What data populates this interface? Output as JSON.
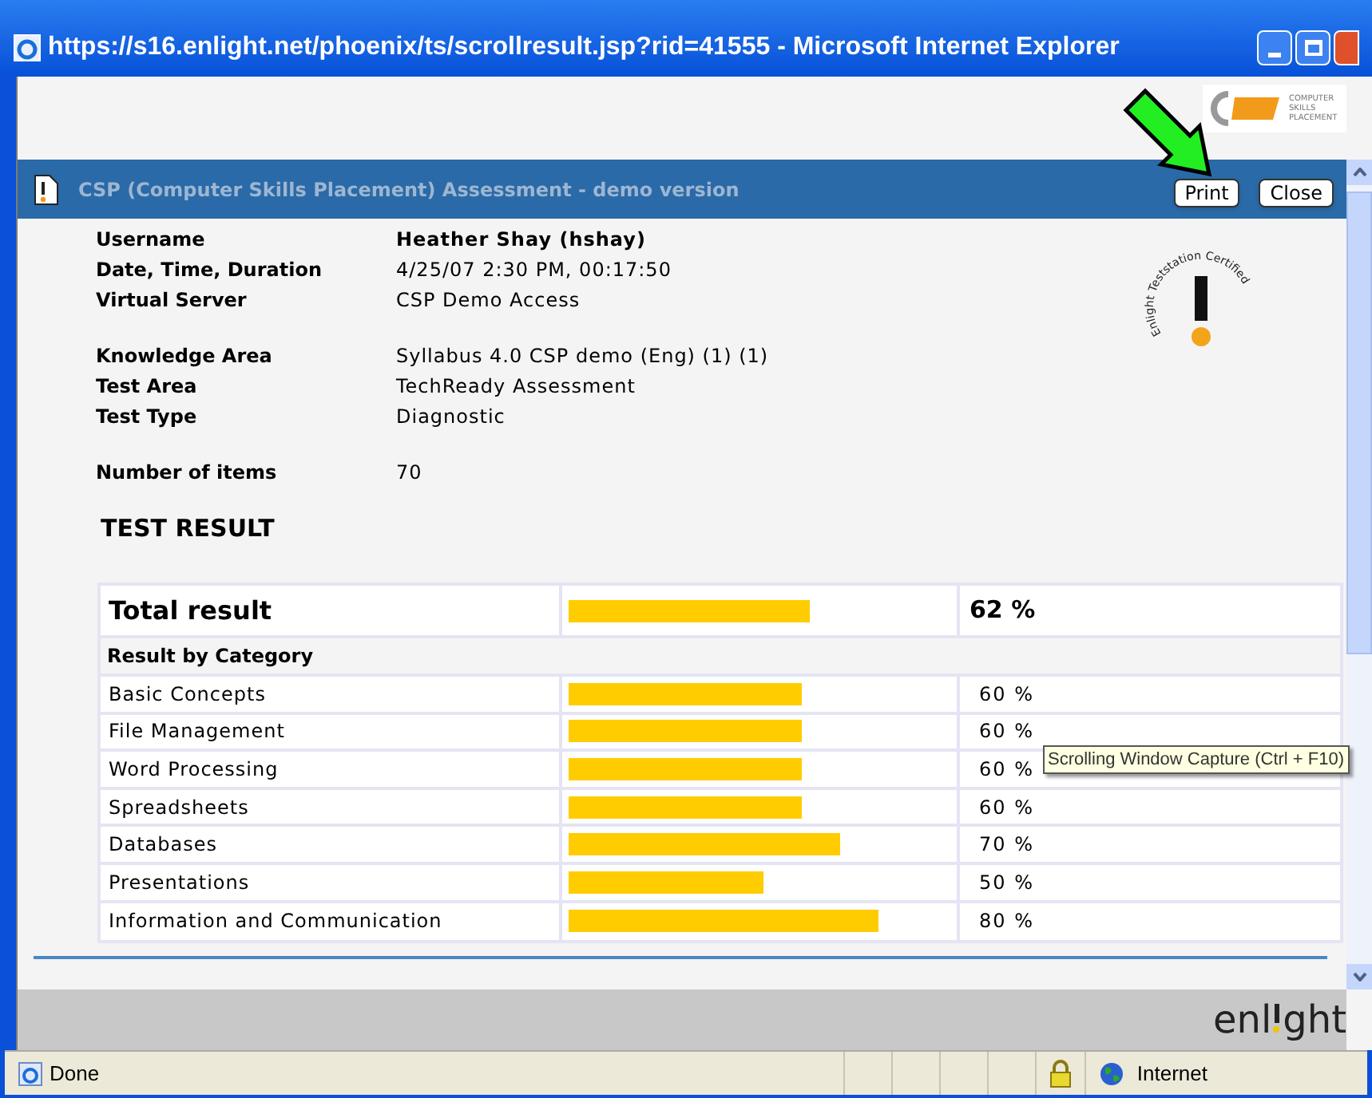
{
  "window": {
    "title": "https://s16.enlight.net/phoenix/ts/scrollresult.jsp?rid=41555 - Microsoft Internet Explorer"
  },
  "header": {
    "title": "CSP (Computer Skills Placement) Assessment - demo version",
    "buttons": [
      "Print",
      "Close"
    ]
  },
  "logo": {
    "lines": [
      "COMPUTER",
      "SKILLS",
      "PLACEMENT"
    ]
  },
  "seal": {
    "text": "Enlight Teststation Certified"
  },
  "details": [
    [
      {
        "label": "Username",
        "value": "Heather Shay (hshay)",
        "kind": "strong"
      },
      {
        "label": "Date, Time, Duration",
        "value": "4/25/07 2:30 PM, 00:17:50",
        "kind": "plain"
      },
      {
        "label": "Virtual Server",
        "value": "CSP Demo Access",
        "kind": "plain"
      }
    ],
    [
      {
        "label": "Knowledge Area",
        "value": "Syllabus 4.0 CSP demo (Eng) (1) (1)",
        "kind": "plain"
      },
      {
        "label": "Test Area",
        "value": "TechReady Assessment",
        "kind": "plain"
      },
      {
        "label": "Test Type",
        "value": "Diagnostic",
        "kind": "plain"
      }
    ],
    [
      {
        "label": "Number of items",
        "value": "70",
        "kind": "plain"
      }
    ]
  ],
  "result_heading": "TEST RESULT",
  "total": {
    "name": "Total result",
    "level": 0.62,
    "reading": "62 %"
  },
  "category_heading": "Result by Category",
  "categories": [
    {
      "name": "Basic Concepts",
      "level": 0.6,
      "reading": "60 %"
    },
    {
      "name": "File Management",
      "level": 0.6,
      "reading": "60 %"
    },
    {
      "name": "Word Processing",
      "level": 0.6,
      "reading": "60 %"
    },
    {
      "name": "Spreadsheets",
      "level": 0.6,
      "reading": "60 %"
    },
    {
      "name": "Databases",
      "level": 0.7,
      "reading": "70 %"
    },
    {
      "name": "Presentations",
      "level": 0.5,
      "reading": "50 %"
    },
    {
      "name": "Information and Communication",
      "level": 0.8,
      "reading": "80 %"
    }
  ],
  "tooltip": "Scrolling Window Capture (Ctrl + F10)",
  "footer": {
    "brand": [
      "enl",
      "ght"
    ]
  },
  "status_bar": {
    "status": "Done",
    "zone": "Internet"
  }
}
